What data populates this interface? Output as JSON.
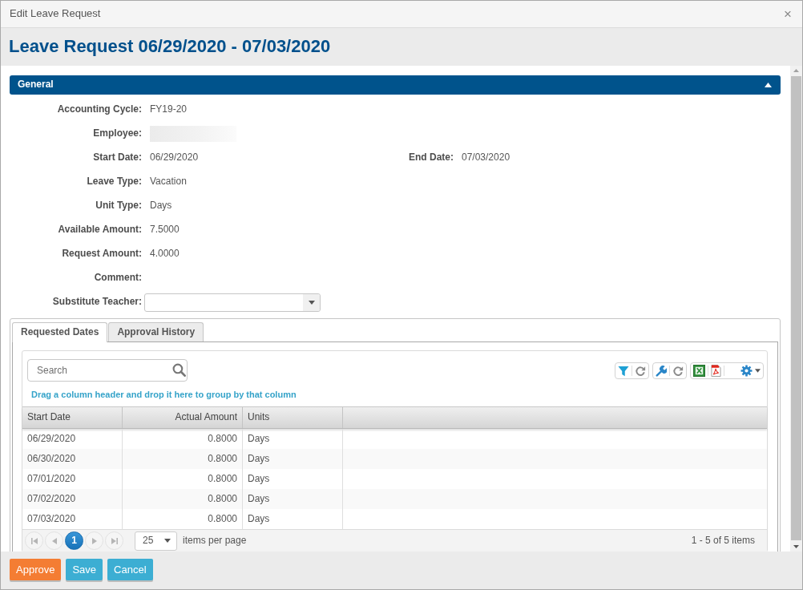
{
  "dialog": {
    "title": "Edit Leave Request",
    "close": "×"
  },
  "header": {
    "title": "Leave Request 06/29/2020 - 07/03/2020"
  },
  "section": {
    "title": "General",
    "expanded": true
  },
  "form_rows": [
    {
      "fields": [
        {
          "kind": "text",
          "label": "Accounting Cycle:",
          "value": "FY19-20"
        }
      ]
    },
    {
      "fields": [
        {
          "kind": "redacted",
          "label": "Employee:"
        }
      ]
    },
    {
      "fields": [
        {
          "kind": "text",
          "label": "Start Date:",
          "value": "06/29/2020"
        },
        {
          "kind": "text",
          "label": "End Date:",
          "value": "07/03/2020"
        }
      ]
    },
    {
      "fields": [
        {
          "kind": "text",
          "label": "Leave Type:",
          "value": "Vacation"
        }
      ]
    },
    {
      "fields": [
        {
          "kind": "text",
          "label": "Unit Type:",
          "value": "Days"
        }
      ]
    },
    {
      "fields": [
        {
          "kind": "text",
          "label": "Available Amount:",
          "value": "7.5000"
        }
      ]
    },
    {
      "fields": [
        {
          "kind": "text",
          "label": "Request Amount:",
          "value": "4.0000"
        }
      ]
    },
    {
      "fields": [
        {
          "kind": "text",
          "label": "Comment:"
        }
      ]
    },
    {
      "fields": [
        {
          "kind": "select",
          "label": "Substitute Teacher:"
        }
      ]
    }
  ],
  "tabs": [
    {
      "label": "Requested Dates",
      "selected": true
    },
    {
      "label": "Approval History",
      "selected": false
    }
  ],
  "grid": {
    "search": {
      "placeholder": "Search"
    },
    "group_hint": "Drag a column header and drop it here to group by that column",
    "columns": [
      {
        "label": "Start Date",
        "kind": "text"
      },
      {
        "label": "Actual Amount",
        "kind": "number"
      },
      {
        "label": "Units",
        "kind": "text"
      }
    ],
    "rows": [
      [
        "06/29/2020",
        "0.8000",
        "Days"
      ],
      [
        "06/30/2020",
        "0.8000",
        "Days"
      ],
      [
        "07/01/2020",
        "0.8000",
        "Days"
      ],
      [
        "07/02/2020",
        "0.8000",
        "Days"
      ],
      [
        "07/03/2020",
        "0.8000",
        "Days"
      ]
    ],
    "pager": {
      "nav": [
        {
          "kind": "first",
          "disabled": true
        },
        {
          "kind": "prev",
          "disabled": true
        },
        {
          "kind": "next",
          "disabled": true
        },
        {
          "kind": "last",
          "disabled": true
        }
      ],
      "pages": [
        {
          "label": "1",
          "selected": true
        }
      ],
      "page_size": "25",
      "page_size_label": "items per page",
      "summary": "1 - 5 of 5 items"
    }
  },
  "buttons": [
    {
      "label": "Approve",
      "kind": "primary"
    },
    {
      "label": "Save",
      "kind": "secondary"
    },
    {
      "label": "Cancel",
      "kind": "secondary"
    }
  ]
}
